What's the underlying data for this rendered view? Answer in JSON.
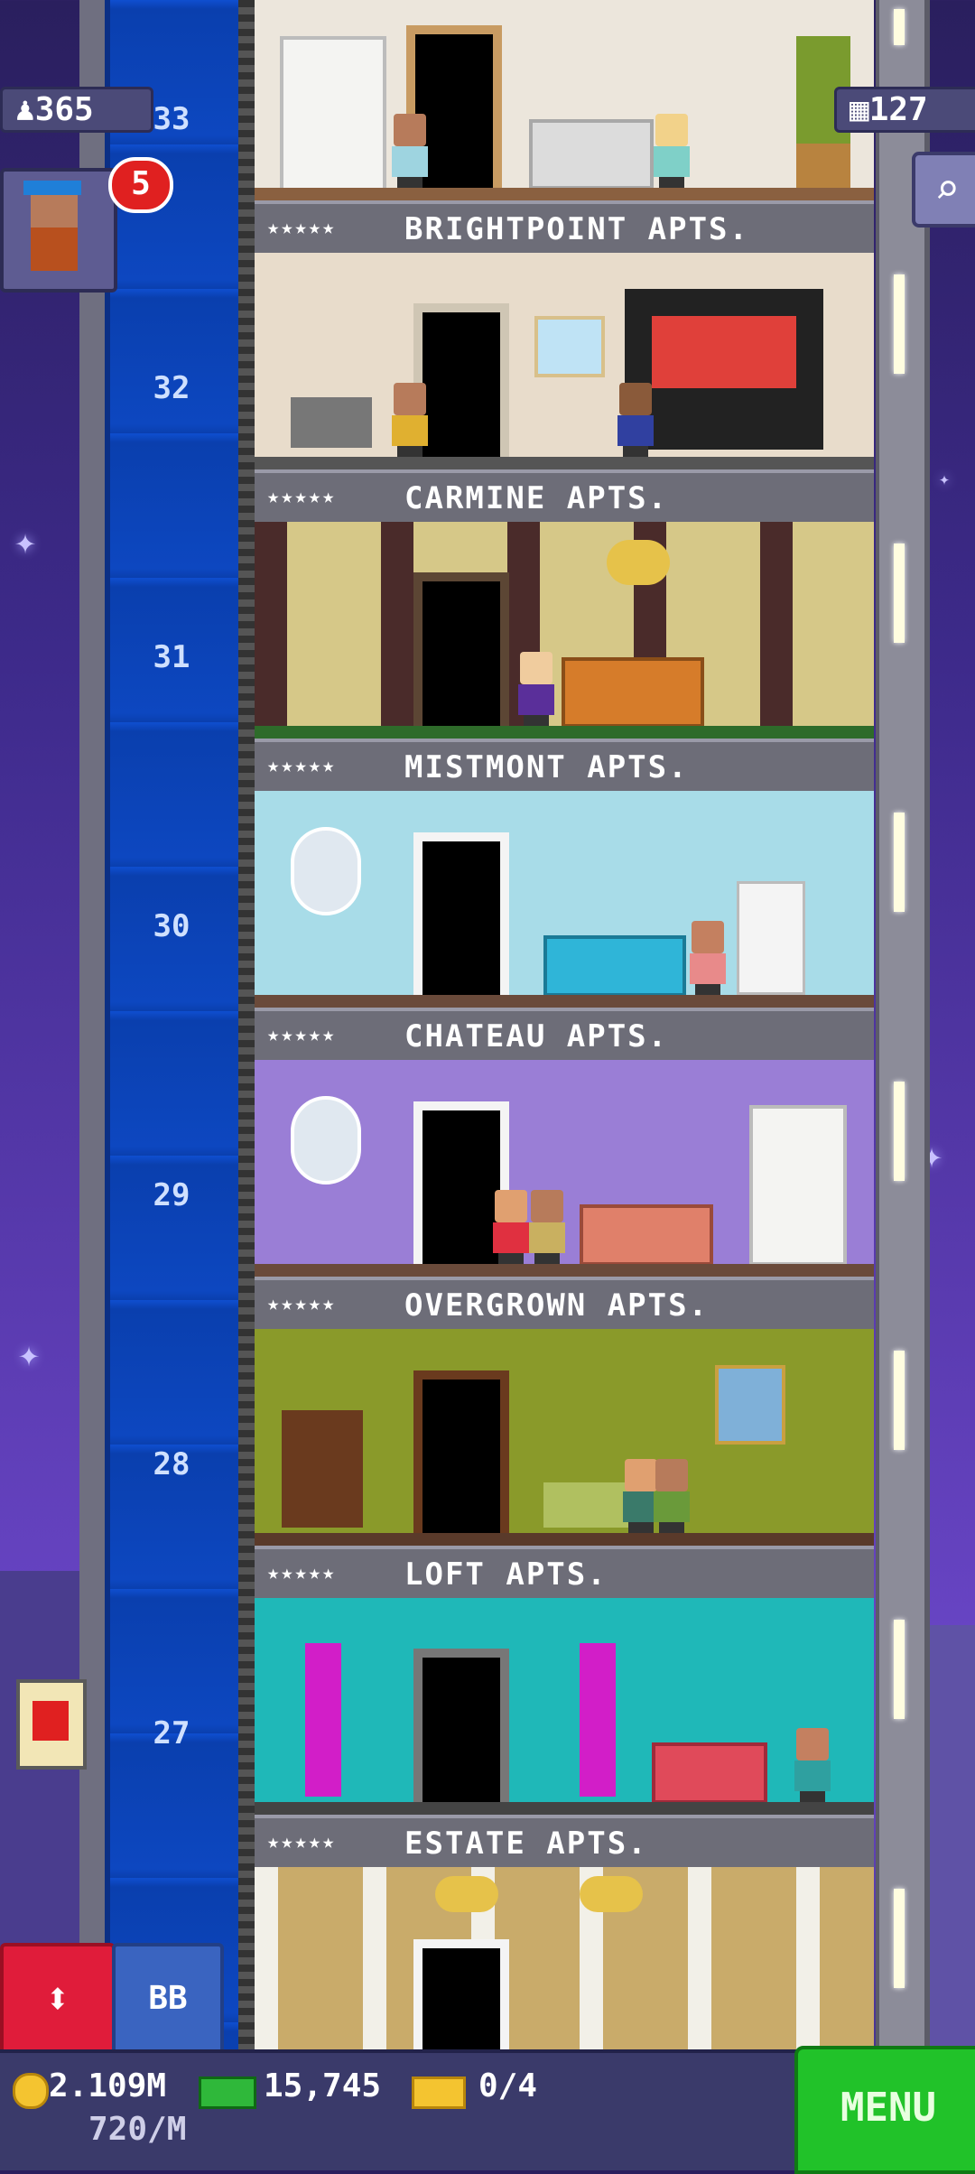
{
  "hud": {
    "population": "365",
    "bux": "127",
    "notification_count": "5"
  },
  "floors": [
    {
      "number": "33",
      "label": "BRIGHTPOINT APTS."
    },
    {
      "number": "32",
      "label": "CARMINE APTS."
    },
    {
      "number": "31",
      "label": "MISTMONT APTS."
    },
    {
      "number": "30",
      "label": "CHATEAU APTS."
    },
    {
      "number": "29",
      "label": "OVERGROWN APTS."
    },
    {
      "number": "28",
      "label": "LOFT APTS."
    },
    {
      "number": "27",
      "label": "ESTATE APTS."
    }
  ],
  "star_rating": "★★★★★",
  "controls": {
    "elevator_icon": "⬍",
    "bb_label": "BB",
    "menu_label": "MENU",
    "search_icon": "⌕"
  },
  "stats": {
    "coins": "2.109M",
    "coins_rate": "720/M",
    "bux_cash": "15,745",
    "tickets": "0/4"
  },
  "colors": {
    "elevator": "#0f4fd0",
    "menu": "#21c229",
    "badge": "#e02020"
  }
}
